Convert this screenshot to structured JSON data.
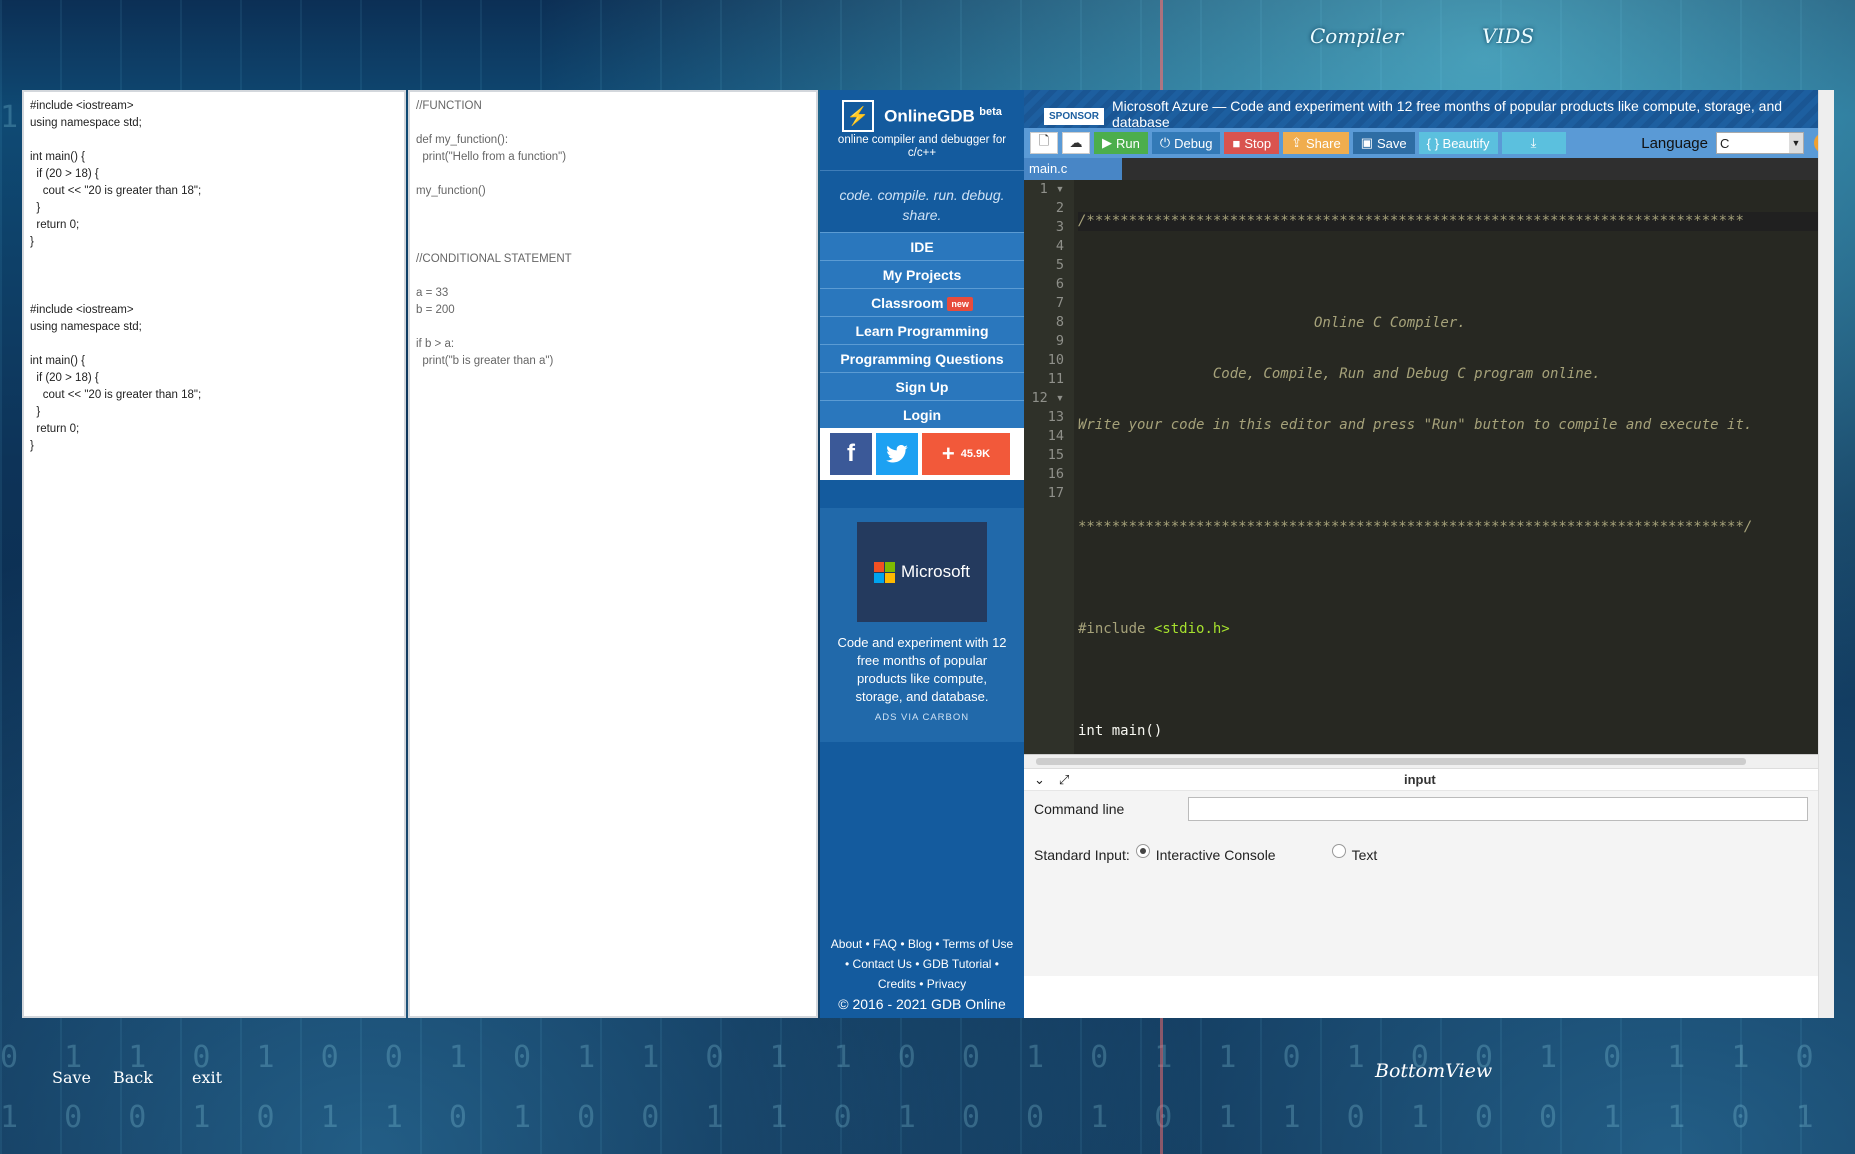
{
  "desktop": {
    "top_links": [
      "Compiler",
      "VIDS"
    ],
    "bottom_links": [
      "Save",
      "Back",
      "exit"
    ],
    "bottom_view": "BottomView"
  },
  "note_left": {
    "text": "#include <iostream>\nusing namespace std;\n\nint main() {\n  if (20 > 18) {\n    cout << \"20 is greater than 18\";\n  }\n  return 0;\n}\n\n\n\n#include <iostream>\nusing namespace std;\n\nint main() {\n  if (20 > 18) {\n    cout << \"20 is greater than 18\";\n  }\n  return 0;\n}"
  },
  "note_right": {
    "text": "//FUNCTION\n\ndef my_function():\n  print(\"Hello from a function\")\n\nmy_function()\n\n\n\n//CONDITIONAL STATEMENT\n\na = 33\nb = 200\n\nif b > a:\n  print(\"b is greater than a\")"
  },
  "gdb": {
    "brand": "OnlineGDB",
    "beta": "beta",
    "subtitle": "online compiler and debugger for c/c++",
    "tagline": "code. compile. run. debug. share.",
    "nav": [
      "IDE",
      "My Projects",
      "Classroom",
      "Learn Programming",
      "Programming Questions",
      "Sign Up",
      "Login"
    ],
    "new_badge": "new",
    "share_count": "45.9K",
    "ad_brand": "Microsoft",
    "ad_text": "Code and experiment with 12 free months of popular products like compute, storage, and database.",
    "ad_via": "ADS VIA CARBON",
    "footer_line1": "About • FAQ • Blog • Terms of Use",
    "footer_line2": "• Contact Us • GDB Tutorial •",
    "footer_line3": "Credits • Privacy",
    "copyright": "© 2016 - 2021 GDB Online",
    "sponsor_tag": "SPONSOR",
    "sponsor_text": "Microsoft Azure — Code and experiment with 12 free months of popular products like compute, storage, and database",
    "toolbar": {
      "run": "Run",
      "debug": "Debug",
      "stop": "Stop",
      "share": "Share",
      "save": "Save",
      "beautify": "{ } Beautify",
      "language_label": "Language",
      "language_value": "C"
    },
    "file_tab": "main.c",
    "io": {
      "title": "input",
      "command_line": "Command line",
      "standard_input": "Standard Input:",
      "opt_console": "Interactive Console",
      "opt_text": "Text"
    }
  },
  "colors": {
    "gdb_blue": "#145b9e",
    "editor_bg": "#272822",
    "run_green": "#4cae4c",
    "stop_red": "#d9534f",
    "share_orange": "#f0ad4e"
  }
}
